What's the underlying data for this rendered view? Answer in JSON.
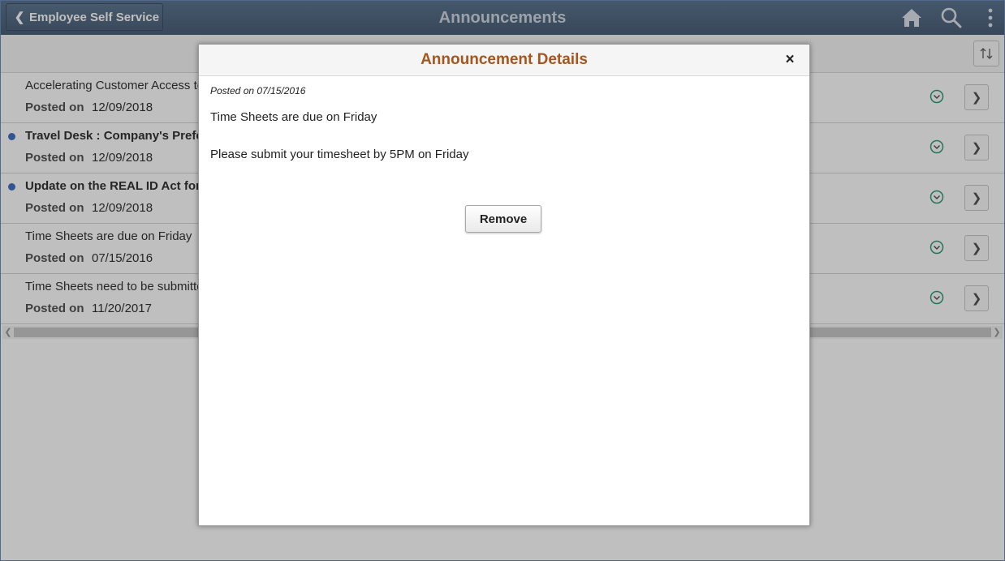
{
  "header": {
    "back_label": "Employee Self Service",
    "title": "Announcements",
    "icons": [
      "home-icon",
      "search-icon",
      "more-vertical-icon"
    ]
  },
  "list": {
    "posted_label": "Posted on",
    "rows": [
      {
        "title": "Accelerating Customer Access to",
        "date": "12/09/2018",
        "unread": false
      },
      {
        "title": "Travel Desk : Company's Prefe",
        "date": "12/09/2018",
        "unread": true
      },
      {
        "title": "Update on the REAL ID Act for",
        "date": "12/09/2018",
        "unread": true
      },
      {
        "title": "Time Sheets are due on Friday",
        "date": "07/15/2016",
        "unread": false
      },
      {
        "title": "Time Sheets need to be submitte",
        "date": "11/20/2017",
        "unread": false
      }
    ]
  },
  "modal": {
    "title": "Announcement Details",
    "close_label": "×",
    "posted_on": "Posted on 07/15/2016",
    "subject": "Time Sheets are due on Friday",
    "body": "Please submit your timesheet by 5PM on Friday",
    "remove_label": "Remove"
  },
  "colors": {
    "header_bg": "#4f657d",
    "modal_title": "#a4561f",
    "unread_dot": "#4571c4",
    "status_icon": "#2f9e74"
  }
}
